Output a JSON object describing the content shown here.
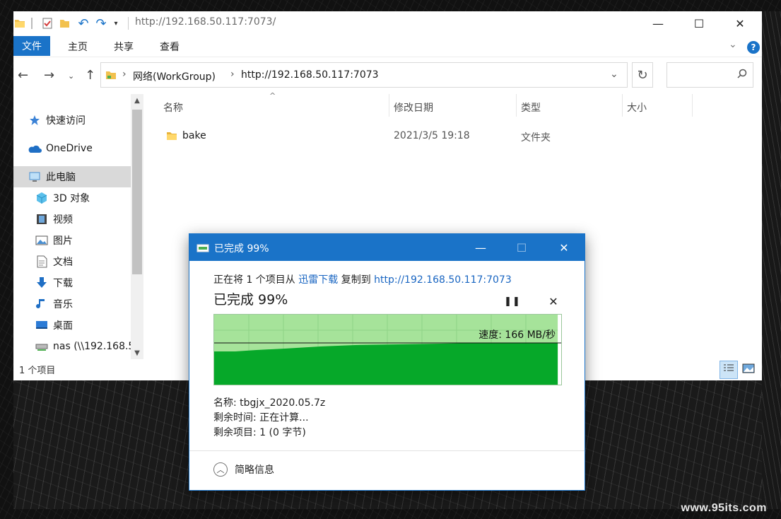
{
  "explorer": {
    "title_path": "http://192.168.50.117:7073/",
    "ribbon_tabs": [
      "文件",
      "主页",
      "共享",
      "查看"
    ],
    "address": {
      "crumb1": "网络(WorkGroup)",
      "crumb2": "http://192.168.50.117:7073"
    },
    "search_placeholder": "",
    "nav_items": [
      {
        "label": "快速访问",
        "icon": "star-icon"
      },
      {
        "label": "OneDrive",
        "icon": "cloud-icon"
      },
      {
        "label": "此电脑",
        "icon": "computer-icon",
        "selected": true
      },
      {
        "label": "3D 对象",
        "icon": "cube-icon"
      },
      {
        "label": "视频",
        "icon": "video-icon"
      },
      {
        "label": "图片",
        "icon": "picture-icon"
      },
      {
        "label": "文档",
        "icon": "document-icon"
      },
      {
        "label": "下载",
        "icon": "download-icon"
      },
      {
        "label": "音乐",
        "icon": "music-icon"
      },
      {
        "label": "桌面",
        "icon": "desktop-icon"
      },
      {
        "label": "nas (\\\\192.168.5",
        "icon": "network-drive-icon"
      }
    ],
    "columns": [
      "名称",
      "修改日期",
      "类型",
      "大小"
    ],
    "files": [
      {
        "name": "bake",
        "modified": "2021/3/5 19:18",
        "type": "文件夹",
        "size": ""
      }
    ],
    "status": "1 个项目"
  },
  "dialog": {
    "title": "已完成 99%",
    "desc_prefix": "正在将 1 个项目从 ",
    "source": "迅雷下载",
    "desc_middle": " 复制到 ",
    "destination": "http://192.168.50.117:7073",
    "percent_text": "已完成 99%",
    "progress": 0.99,
    "speed": "速度: 166 MB/秒",
    "name_line": "名称: tbgjx_2020.05.7z",
    "time_line": "剩余时间: 正在计算...",
    "items_line": "剩余项目: 1 (0 字节)",
    "less_details": "简略信息"
  },
  "watermark": "www.95its.com",
  "colors": {
    "accent": "#1a73c8",
    "progress_dark": "#06a829",
    "progress_light": "#a6e39a"
  }
}
